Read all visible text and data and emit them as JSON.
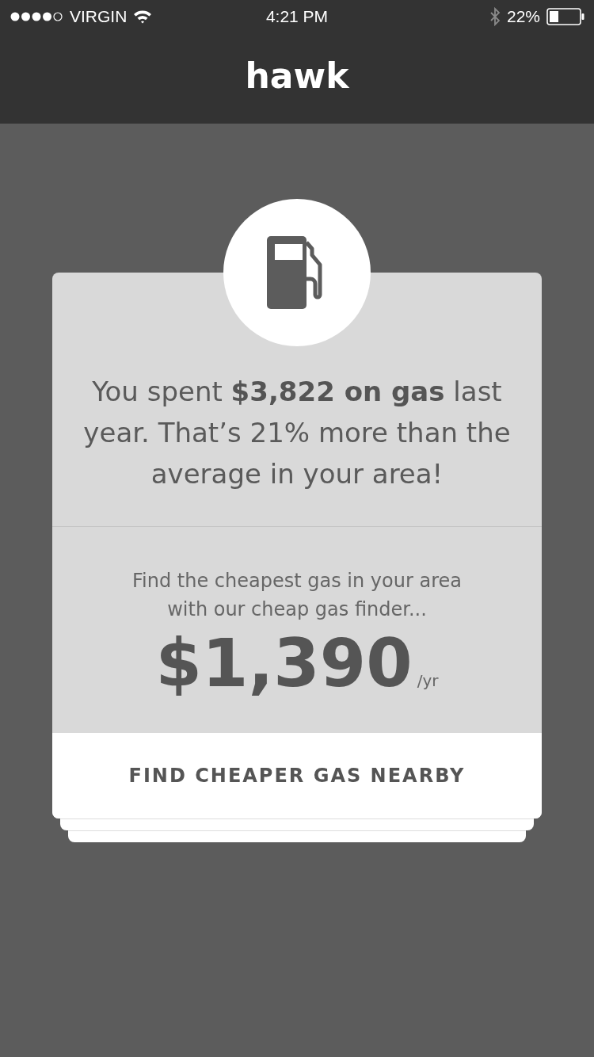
{
  "status_bar": {
    "carrier": "VIRGIN",
    "time": "4:21 PM",
    "battery": "22%"
  },
  "header": {
    "title": "hawk"
  },
  "card": {
    "message": "You spent **$3,822 on gas** last year. That’s 21% more than the average in your area!",
    "subtitle": "Find the cheapest gas in your area with our cheap gas finder...",
    "amount": "$1,390",
    "unit": "/yr",
    "button": "FIND CHEAPER GAS NEARBY"
  }
}
